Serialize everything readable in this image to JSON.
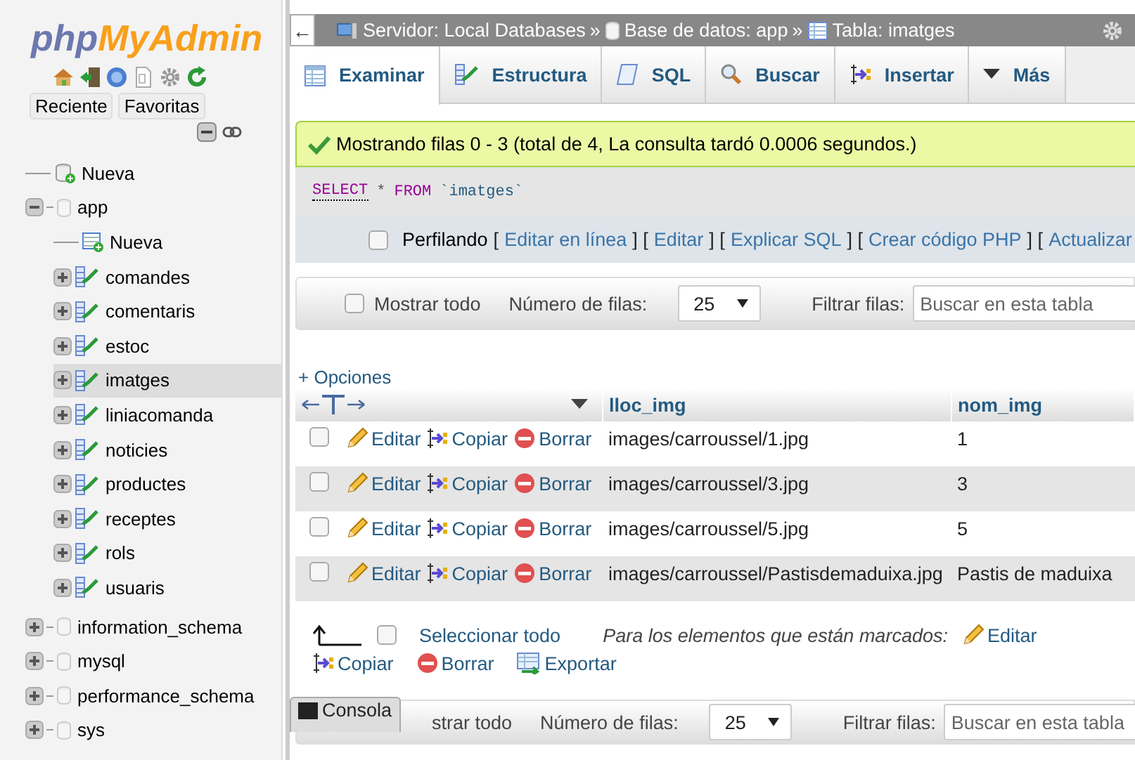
{
  "sidebar": {
    "logo_php": "php",
    "logo_myadmin": "MyAdmin",
    "tabs": [
      {
        "label": "Reciente"
      },
      {
        "label": "Favoritas"
      }
    ],
    "tree": [
      {
        "label": "Nueva",
        "kind": "new"
      },
      {
        "label": "app",
        "kind": "db",
        "expanded": true,
        "children": [
          {
            "label": "Nueva",
            "kind": "newtable"
          },
          {
            "label": "comandes",
            "kind": "table",
            "selected": false
          },
          {
            "label": "comentaris",
            "kind": "table",
            "selected": false
          },
          {
            "label": "estoc",
            "kind": "table",
            "selected": false
          },
          {
            "label": "imatges",
            "kind": "table",
            "selected": true
          },
          {
            "label": "liniacomanda",
            "kind": "table",
            "selected": false
          },
          {
            "label": "noticies",
            "kind": "table",
            "selected": false
          },
          {
            "label": "productes",
            "kind": "table",
            "selected": false
          },
          {
            "label": "receptes",
            "kind": "table",
            "selected": false
          },
          {
            "label": "rols",
            "kind": "table",
            "selected": false
          },
          {
            "label": "usuaris",
            "kind": "table",
            "selected": false
          }
        ]
      },
      {
        "label": "information_schema",
        "kind": "db",
        "expanded": false
      },
      {
        "label": "mysql",
        "kind": "db",
        "expanded": false
      },
      {
        "label": "performance_schema",
        "kind": "db",
        "expanded": false
      },
      {
        "label": "sys",
        "kind": "db",
        "expanded": false
      }
    ]
  },
  "back_arrow": "←",
  "breadcrumb": [
    {
      "label": "Servidor: Local Databases",
      "kind": "server",
      "separator": "»"
    },
    {
      "label": "Base de datos: app",
      "kind": "db",
      "separator": "»"
    },
    {
      "label": "Tabla: imatges",
      "kind": "table"
    }
  ],
  "tabs": [
    {
      "label": "Examinar",
      "kind": "browse",
      "selected": true
    },
    {
      "label": "Estructura",
      "kind": "structure",
      "selected": false
    },
    {
      "label": "SQL",
      "kind": "sql",
      "selected": false
    },
    {
      "label": "Buscar",
      "kind": "search",
      "selected": false
    },
    {
      "label": "Insertar",
      "kind": "insert",
      "selected": false
    },
    {
      "label": "Más",
      "kind": "more",
      "selected": false
    }
  ],
  "message": "Mostrando filas 0 - 3 (total de 4, La consulta tardó 0.0006 segundos.)",
  "query": [
    {
      "text": "SELECT",
      "kind": "keyword"
    },
    {
      "text": "*",
      "kind": "operator"
    },
    {
      "text": "FROM",
      "kind": "keyword"
    },
    {
      "text": "`imatges`",
      "kind": "identifier"
    }
  ],
  "profiling": {
    "label": "Perfilando",
    "checked": false,
    "segments": [
      {
        "kind": "bracket",
        "text": "["
      },
      {
        "kind": "link",
        "text": "Editar en línea"
      },
      {
        "kind": "bracket",
        "text": "] ["
      },
      {
        "kind": "link",
        "text": "Editar"
      },
      {
        "kind": "bracket",
        "text": "] ["
      },
      {
        "kind": "link",
        "text": "Explicar SQL"
      },
      {
        "kind": "bracket",
        "text": "] ["
      },
      {
        "kind": "link",
        "text": "Crear código PHP"
      },
      {
        "kind": "bracket",
        "text": "] ["
      },
      {
        "kind": "link",
        "text": "Actualizar"
      }
    ]
  },
  "nav_top": {
    "show_all": "Mostrar todo",
    "show_all_checked": false,
    "rows_label": "Número de filas:",
    "rows_value": "25",
    "filter_label": "Filtrar filas:",
    "filter_placeholder": "Buscar en esta tabla"
  },
  "options_link": "+ Opciones",
  "table": {
    "columns": [
      {
        "label": "lloc_img"
      },
      {
        "label": "nom_img"
      }
    ],
    "rows": [
      {
        "selected": false,
        "actions": [
          {
            "label": "Editar",
            "kind": "edit"
          },
          {
            "label": "Copiar",
            "kind": "copy"
          },
          {
            "label": "Borrar",
            "kind": "delete"
          }
        ],
        "cells": [
          "images/carroussel/1.jpg",
          "1"
        ]
      },
      {
        "selected": false,
        "actions": [
          {
            "label": "Editar",
            "kind": "edit"
          },
          {
            "label": "Copiar",
            "kind": "copy"
          },
          {
            "label": "Borrar",
            "kind": "delete"
          }
        ],
        "cells": [
          "images/carroussel/3.jpg",
          "3"
        ]
      },
      {
        "selected": false,
        "actions": [
          {
            "label": "Editar",
            "kind": "edit"
          },
          {
            "label": "Copiar",
            "kind": "copy"
          },
          {
            "label": "Borrar",
            "kind": "delete"
          }
        ],
        "cells": [
          "images/carroussel/5.jpg",
          "5"
        ]
      },
      {
        "selected": false,
        "actions": [
          {
            "label": "Editar",
            "kind": "edit"
          },
          {
            "label": "Copiar",
            "kind": "copy"
          },
          {
            "label": "Borrar",
            "kind": "delete"
          }
        ],
        "cells": [
          "images/carroussel/Pastisdemaduixa.jpg",
          "Pastis de maduixa"
        ]
      }
    ]
  },
  "bulk": {
    "select_all": "Seleccionar todo",
    "select_all_checked": false,
    "hint": "Para los elementos que están marcados:",
    "actions": [
      {
        "label": "Editar",
        "kind": "edit"
      },
      {
        "label": "Copiar",
        "kind": "copy"
      },
      {
        "label": "Borrar",
        "kind": "delete"
      },
      {
        "label": "Exportar",
        "kind": "export"
      }
    ]
  },
  "console": "Consola",
  "nav_bottom": {
    "show_all": "strar todo",
    "rows_label": "Número de filas:",
    "rows_value": "25",
    "filter_label": "Filtrar filas:",
    "filter_placeholder": "Buscar en esta tabla"
  }
}
